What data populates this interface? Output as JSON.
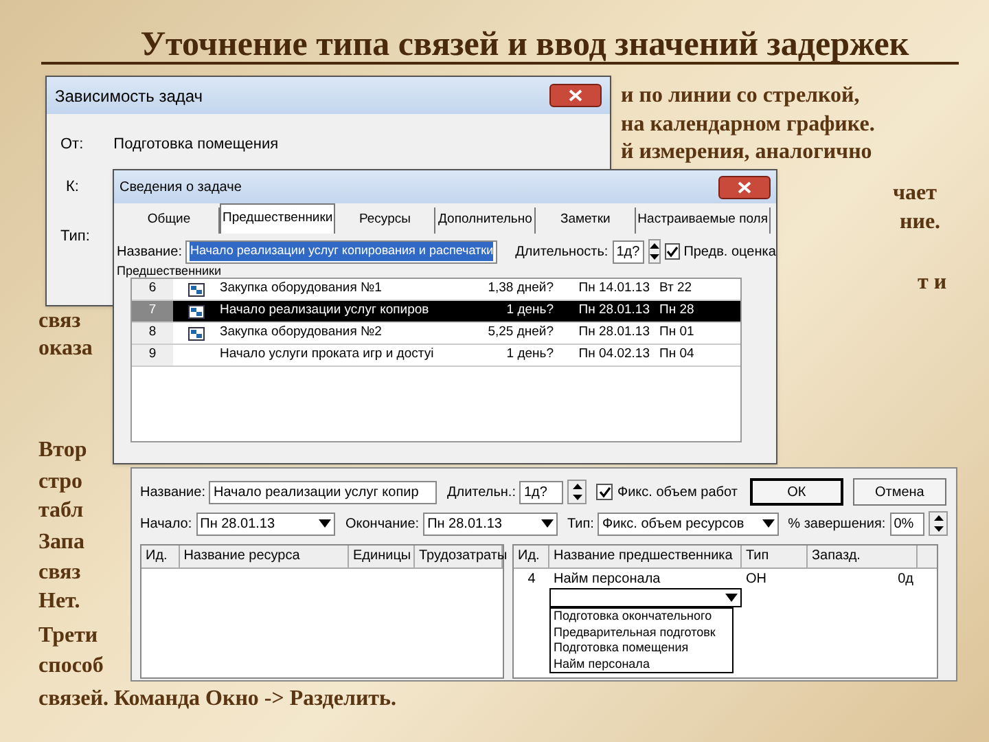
{
  "slide": {
    "title": "Уточнение типа связей и ввод значений задержек",
    "text_fragments": [
      "и по линии со стрелкой,",
      "на календарном графике.",
      "й измерения, аналогично",
      "чает",
      "ние.",
      "т и",
      "связ",
      "оказа",
      "Втор",
      "стро",
      "табл",
      "Запа",
      "связ",
      "Нет.",
      "Трети",
      "способ",
      "связей. Команда Окно -> Разделить."
    ]
  },
  "dependency_dialog": {
    "title": "Зависимость задач",
    "from_label": "От:",
    "from_value": "Подготовка помещения",
    "to_label": "К:",
    "type_label": "Тип:"
  },
  "task_info": {
    "title": "Сведения о задаче",
    "tabs": [
      {
        "label": "Общие",
        "selected": false
      },
      {
        "label": "Предшественники",
        "selected": true
      },
      {
        "label": "Ресурсы",
        "selected": false
      },
      {
        "label": "Дополнительно",
        "selected": false
      },
      {
        "label": "Заметки",
        "selected": false
      },
      {
        "label": "Настраиваемые поля",
        "selected": false
      }
    ],
    "name_label": "Название:",
    "name_value": "Начало реализации услуг копирования и распечатки",
    "duration_label": "Длительность:",
    "duration_value": "1д?",
    "estimate": {
      "label": "Предв. оценка",
      "checked": true
    },
    "predecessors_label": "Предшественники",
    "rows": [
      {
        "id": "6",
        "has_icon": true,
        "name": "Закупка оборудования №1",
        "duration": "1,38 дней?",
        "start": "Пн 14.01.13",
        "finish": "Вт 22",
        "selected": false
      },
      {
        "id": "7",
        "has_icon": true,
        "name": "Начало реализации услуг копиров",
        "duration": "1 день?",
        "start": "Пн 28.01.13",
        "finish": "Пн 28",
        "selected": true
      },
      {
        "id": "8",
        "has_icon": true,
        "name": "Закупка оборудования №2",
        "duration": "5,25 дней?",
        "start": "Пн 28.01.13",
        "finish": "Пн 01",
        "selected": false
      },
      {
        "id": "9",
        "has_icon": false,
        "name": "Начало услуги проката игр и достуі",
        "duration": "1 день?",
        "start": "Пн 04.02.13",
        "finish": "Пн 04",
        "selected": false
      }
    ]
  },
  "task_form": {
    "name_label": "Название:",
    "name_value": "Начало реализации услуг копир",
    "duration_label": "Длительн.:",
    "duration_value": "1д?",
    "fixed_work": {
      "label": "Фикс. объем работ",
      "checked": true
    },
    "ok": "ОК",
    "cancel": "Отмена",
    "start_label": "Начало:",
    "start_value": "Пн 28.01.13",
    "finish_label": "Окончание:",
    "finish_value": "Пн 28.01.13",
    "type_label": "Тип:",
    "type_value": "Фикс. объем ресурсов",
    "complete_label": "% завершения:",
    "complete_value": "0%",
    "resource_columns": [
      "Ид.",
      "Название ресурса",
      "Единицы",
      "Трудозатраты"
    ],
    "predecessor_columns": [
      "Ид.",
      "Название предшественника",
      "Тип",
      "Запазд."
    ],
    "predecessor_rows": [
      {
        "id": "4",
        "name": "Найм персонала",
        "type": "ОН",
        "lag": "0д"
      }
    ],
    "dropdown_options": [
      "Подготовка окончательного",
      "Предварительная подготовк",
      "Подготовка помещения",
      "Найм персонала"
    ]
  }
}
